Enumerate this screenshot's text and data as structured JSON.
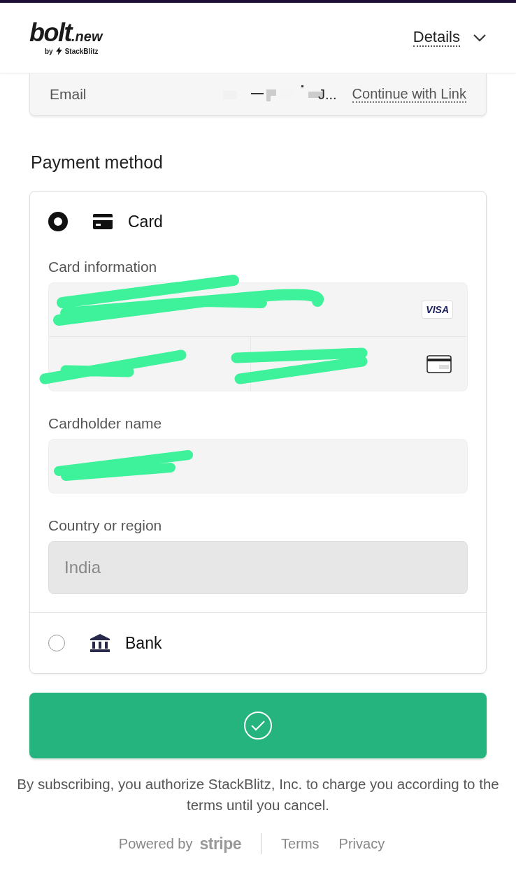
{
  "header": {
    "logo": {
      "wordmark": "bolt",
      "suffix": ".new",
      "byline_prefix": "by",
      "byline": "StackBlitz"
    },
    "details_link": "Details"
  },
  "email": {
    "label": "Email",
    "value": "J...",
    "link": "Continue with Link"
  },
  "payment": {
    "heading": "Payment method",
    "options": [
      {
        "kind": "card",
        "label": "Card",
        "selected": true
      },
      {
        "kind": "bank",
        "label": "Bank",
        "selected": false
      }
    ],
    "card": {
      "info_label": "Card information",
      "brand": "VISA",
      "name_label": "Cardholder name",
      "country_label": "Country or region",
      "country": "India"
    }
  },
  "legal": "By subscribing, you authorize StackBlitz, Inc. to charge you according to the terms until you cancel.",
  "footer": {
    "powered_by": "Powered by",
    "brand": "stripe",
    "links": [
      "Terms",
      "Privacy"
    ]
  }
}
